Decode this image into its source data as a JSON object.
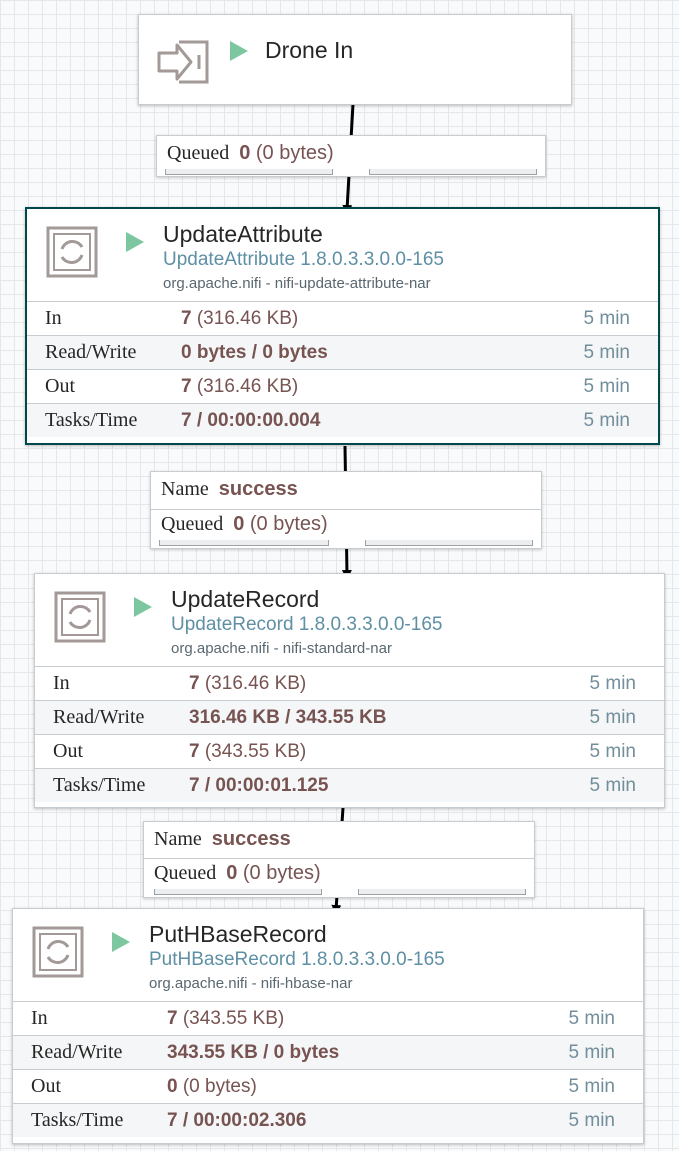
{
  "input_port": {
    "name": "Drone In",
    "status_icon": "play-icon",
    "icon": "input-port-icon"
  },
  "processors": [
    {
      "name": "UpdateAttribute",
      "type": "UpdateAttribute 1.8.0.3.3.0.0-165",
      "bundle": "org.apache.nifi - nifi-update-attribute-nar",
      "selected": true,
      "stats": [
        {
          "label": "In",
          "value": "7",
          "size": "(316.46 KB)",
          "period": "5 min"
        },
        {
          "label": "Read/Write",
          "value": "0 bytes / 0 bytes",
          "size": "",
          "period": "5 min"
        },
        {
          "label": "Out",
          "value": "7",
          "size": "(316.46 KB)",
          "period": "5 min"
        },
        {
          "label": "Tasks/Time",
          "value": "7 / 00:00:00.004",
          "size": "",
          "period": "5 min"
        }
      ]
    },
    {
      "name": "UpdateRecord",
      "type": "UpdateRecord 1.8.0.3.3.0.0-165",
      "bundle": "org.apache.nifi - nifi-standard-nar",
      "selected": false,
      "stats": [
        {
          "label": "In",
          "value": "7",
          "size": "(316.46 KB)",
          "period": "5 min"
        },
        {
          "label": "Read/Write",
          "value": "316.46 KB / 343.55 KB",
          "size": "",
          "period": "5 min"
        },
        {
          "label": "Out",
          "value": "7",
          "size": "(343.55 KB)",
          "period": "5 min"
        },
        {
          "label": "Tasks/Time",
          "value": "7 / 00:00:01.125",
          "size": "",
          "period": "5 min"
        }
      ]
    },
    {
      "name": "PutHBaseRecord",
      "type": "PutHBaseRecord 1.8.0.3.3.0.0-165",
      "bundle": "org.apache.nifi - nifi-hbase-nar",
      "selected": false,
      "stats": [
        {
          "label": "In",
          "value": "7",
          "size": "(343.55 KB)",
          "period": "5 min"
        },
        {
          "label": "Read/Write",
          "value": "343.55 KB / 0 bytes",
          "size": "",
          "period": "5 min"
        },
        {
          "label": "Out",
          "value": "0",
          "size": "(0 bytes)",
          "period": "5 min"
        },
        {
          "label": "Tasks/Time",
          "value": "7 / 00:00:02.306",
          "size": "",
          "period": "5 min"
        }
      ]
    }
  ],
  "connections": [
    {
      "name_label": "",
      "name": "",
      "queued_label": "Queued",
      "queued_count": "0",
      "queued_size": "(0 bytes)"
    },
    {
      "name_label": "Name",
      "name": "success",
      "queued_label": "Queued",
      "queued_count": "0",
      "queued_size": "(0 bytes)"
    },
    {
      "name_label": "Name",
      "name": "success",
      "queued_label": "Queued",
      "queued_count": "0",
      "queued_size": "(0 bytes)"
    }
  ],
  "colors": {
    "run": "#7dc7a0",
    "value": "#775351",
    "type": "#5e8fa4",
    "period": "#728e9b",
    "selected_border": "#004849"
  }
}
